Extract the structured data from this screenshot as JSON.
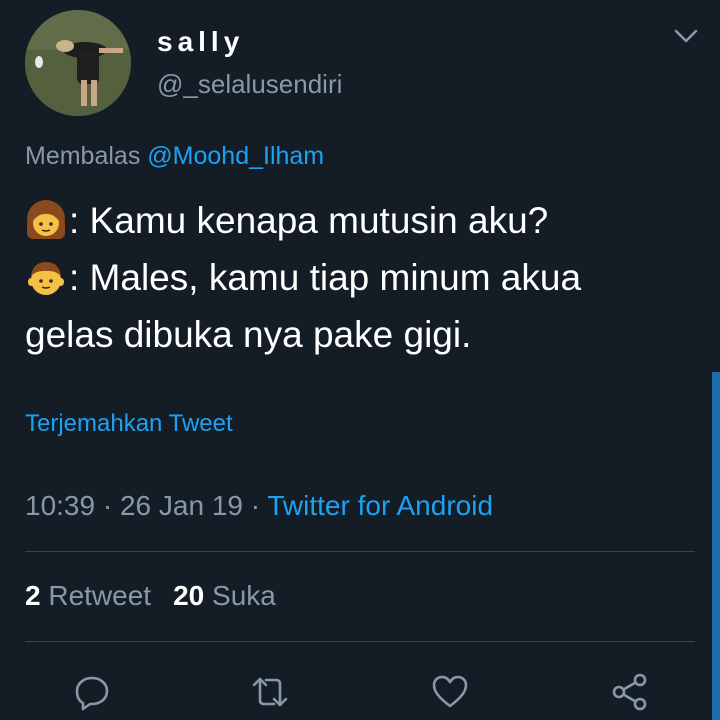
{
  "tweet": {
    "display_name": "sally",
    "handle": "@_selalusendiri",
    "reply_prefix": "Membalas",
    "reply_mention": "@Moohd_Ilham",
    "lines": [
      ": Kamu kenapa mutusin aku?",
      ": Males, kamu tiap minum akua",
      "gelas dibuka nya pake gigi."
    ],
    "emoji_1": "woman-emoji",
    "emoji_2": "boy-emoji",
    "translate_label": "Terjemahkan Tweet",
    "time": "10:39",
    "separator": " · ",
    "date": "26 Jan 19",
    "source": "Twitter for Android",
    "retweet_count": "2",
    "retweet_label": "Retweet",
    "like_count": "20",
    "like_label": "Suka"
  },
  "icons": {
    "reply": "reply-icon",
    "retweet": "retweet-icon",
    "like": "heart-icon",
    "share": "share-icon",
    "menu": "chevron-down-icon"
  },
  "colors": {
    "background": "#141d26",
    "accent": "#1da1f2",
    "secondary_text": "#8899a6",
    "divider": "#38444d"
  }
}
